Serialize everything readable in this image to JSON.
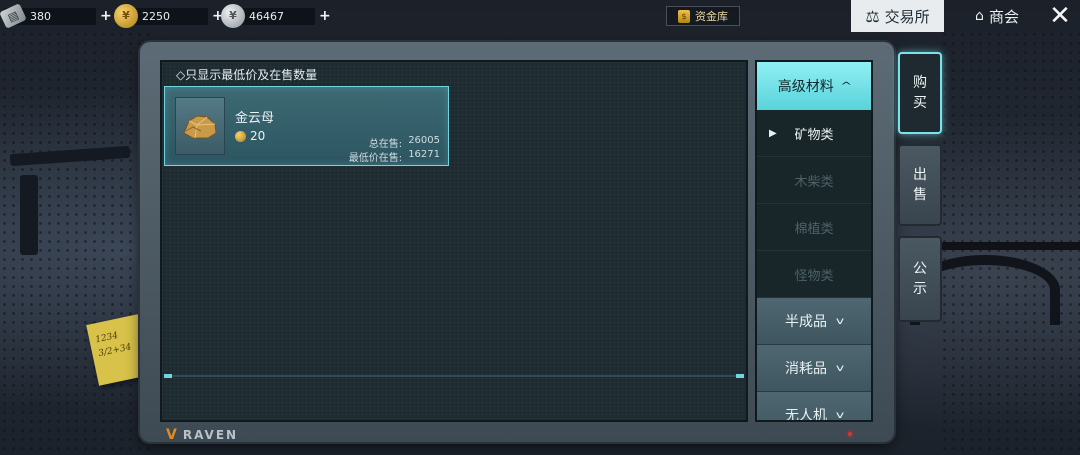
{
  "currencies": [
    {
      "icon": "ticket-icon",
      "value": "380",
      "plus": "+"
    },
    {
      "icon": "gold-coin-icon",
      "value": "2250",
      "plus": "+"
    },
    {
      "icon": "silver-coin-icon",
      "value": "46467",
      "plus": "+"
    }
  ],
  "vault": {
    "label": "资金库",
    "icon": "vault-icon"
  },
  "nav": {
    "trade_label": "交易所",
    "shop_label": "商会",
    "close_glyph": "✕"
  },
  "filter": {
    "label": "◇只显示最低价及在售数量"
  },
  "item": {
    "name": "金云母",
    "price": "20",
    "total_label": "总在售:",
    "total_value": "26005",
    "lowest_label": "最低价在售:",
    "lowest_value": "16271"
  },
  "categories": {
    "header": "高级材料",
    "subs": [
      {
        "label": "矿物类",
        "state": "active"
      },
      {
        "label": "木柴类",
        "state": "dim"
      },
      {
        "label": "棉植类",
        "state": "dim"
      },
      {
        "label": "怪物类",
        "state": "dim"
      }
    ],
    "groups": [
      "半成品",
      "消耗品",
      "无人机"
    ]
  },
  "side_tabs": {
    "buy": [
      "购",
      "买"
    ],
    "sell": [
      "出",
      "售"
    ],
    "notice": [
      "公",
      "示"
    ]
  },
  "brand": "RAVEN",
  "sticky_note": [
    "1234",
    "3/2+34"
  ],
  "colors": {
    "accent": "#6fd6df",
    "gold": "#d8a93a",
    "tab_active_bg": "#e8ecee"
  }
}
